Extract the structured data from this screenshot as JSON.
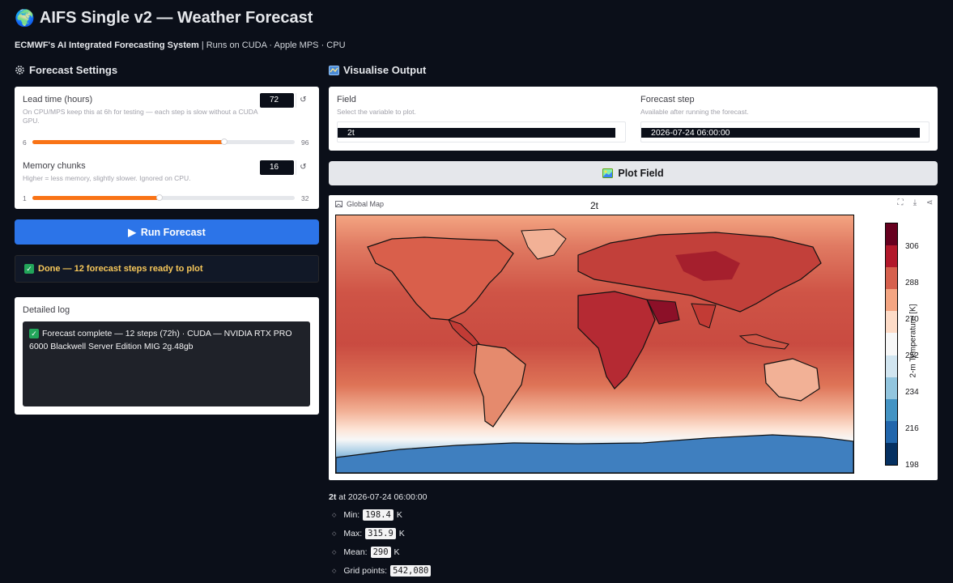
{
  "header": {
    "globe_emoji": "🌍",
    "title": "AIFS Single v2 — Weather Forecast",
    "subtitle_bold": "ECMWF's AI Integrated Forecasting System",
    "subtitle_rest": " | Runs on CUDA · Apple MPS · CPU"
  },
  "settings": {
    "title": "Forecast Settings",
    "lead_time": {
      "label": "Lead time (hours)",
      "hint": "On CPU/MPS keep this at 6h for testing — each step is slow without a CUDA GPU.",
      "value": "72",
      "min": "6",
      "max": "96",
      "fraction": 0.733
    },
    "memory_chunks": {
      "label": "Memory chunks",
      "hint": "Higher = less memory, slightly slower. Ignored on CPU.",
      "value": "16",
      "min": "1",
      "max": "32",
      "fraction": 0.484
    },
    "reset_glyph": "↺"
  },
  "run_button": {
    "label": "Run Forecast",
    "glyph": "▶"
  },
  "status": {
    "text": "Done — 12 forecast steps ready to plot",
    "check": "✓"
  },
  "log": {
    "label": "Detailed log",
    "text": "Forecast complete — 12 steps (72h)  ·  CUDA — NVIDIA RTX PRO 6000 Blackwell Server Edition MIG 2g.48gb"
  },
  "visualise": {
    "title": "Visualise Output",
    "field": {
      "label": "Field",
      "hint": "Select the variable to plot.",
      "value": "2t"
    },
    "forecast_step": {
      "label": "Forecast step",
      "hint": "Available after running the forecast.",
      "value": "2026-07-24 06:00:00"
    }
  },
  "plot_button": {
    "label": "Plot Field"
  },
  "map": {
    "panel_label": "Global Map",
    "plot_title": "2t",
    "colorbar_label": "2-m Temperature  [K]",
    "colorbar_ticks": [
      "306",
      "288",
      "270",
      "252",
      "234",
      "216",
      "198"
    ],
    "colorbar_colors": [
      "#67001f",
      "#b2182b",
      "#d6604d",
      "#f4a582",
      "#fddbc7",
      "#f7f7f7",
      "#d1e5f0",
      "#92c5de",
      "#4393c3",
      "#2166ac",
      "#053061"
    ]
  },
  "stats": {
    "field": "2t",
    "at_text": " at 2026-07-24 06:00:00",
    "min_label": "Min:",
    "min_value": "198.4",
    "max_label": "Max:",
    "max_value": "315.9",
    "mean_label": "Mean:",
    "mean_value": "290",
    "unit": "K",
    "grid_label": "Grid points:",
    "grid_value": "542,080"
  }
}
